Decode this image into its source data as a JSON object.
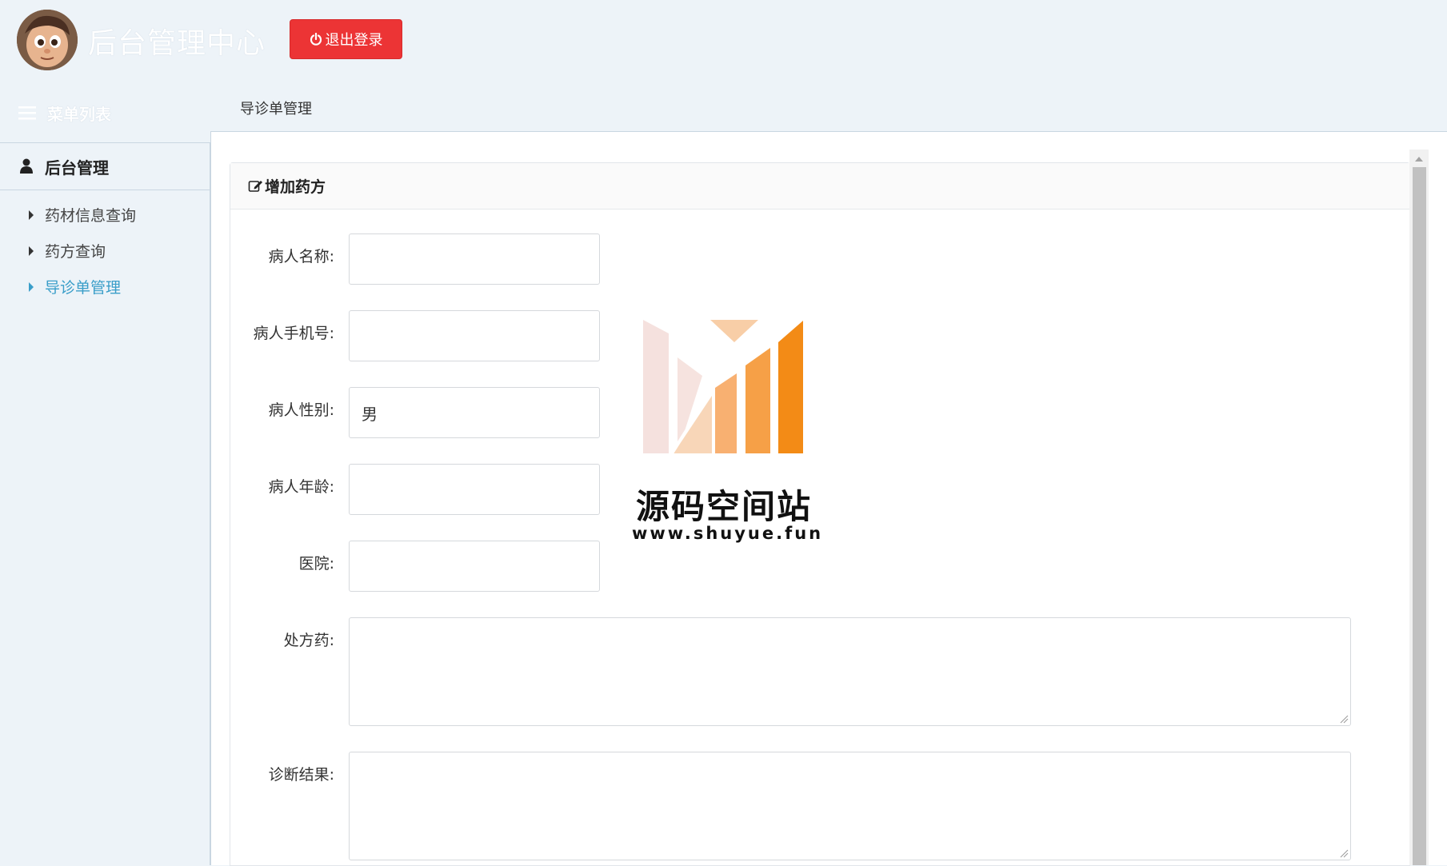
{
  "header": {
    "app_title": "后台管理中心",
    "logout_label": "退出登录"
  },
  "menu": {
    "header_label": "菜单列表",
    "group_label": "后台管理",
    "items": [
      {
        "label": "药材信息查询"
      },
      {
        "label": "药方查询"
      },
      {
        "label": "导诊单管理"
      }
    ],
    "active_index": 2
  },
  "breadcrumb": "导诊单管理",
  "panel": {
    "title": "增加药方"
  },
  "form": {
    "patient_name": {
      "label": "病人名称:",
      "value": ""
    },
    "patient_phone": {
      "label": "病人手机号:",
      "value": ""
    },
    "patient_gender": {
      "label": "病人性别:",
      "value": "男"
    },
    "patient_age": {
      "label": "病人年龄:",
      "value": ""
    },
    "hospital": {
      "label": "医院:",
      "value": ""
    },
    "prescription": {
      "label": "处方药:",
      "value": ""
    },
    "diagnosis": {
      "label": "诊断结果:",
      "value": ""
    }
  },
  "watermark": {
    "name": "源码空间站",
    "url": "www.shuyue.fun"
  },
  "colors": {
    "background": "#edf3f8",
    "logout": "#ec3435",
    "active_link": "#3a9ec9",
    "logo_orange": "#f38b16"
  }
}
